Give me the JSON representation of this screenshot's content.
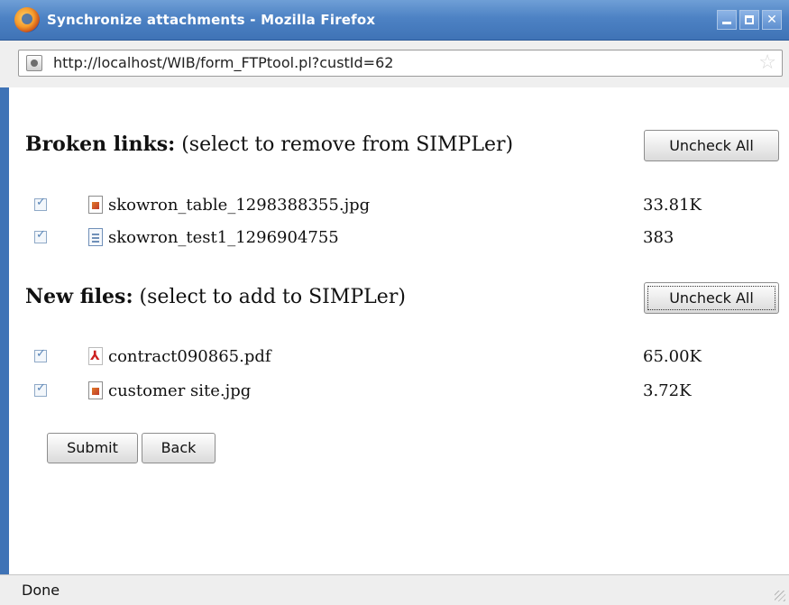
{
  "window": {
    "title": "Synchronize attachments - Mozilla Firefox",
    "icon": "firefox-icon",
    "controls": [
      "minimize-icon",
      "maximize-icon",
      "close-icon"
    ]
  },
  "urlbar": {
    "url": "http://localhost/WIB/form_FTPtool.pl?custId=62",
    "site_icon": "site-identity-icon",
    "bookmark_icon": "bookmark-star-icon"
  },
  "broken_links": {
    "heading_bold": "Broken links:",
    "heading_rest": " (select to remove from SIMPLer)",
    "uncheck_label": "Uncheck All",
    "items": [
      {
        "name": "skowron_table_1298388355.jpg",
        "size": "33.81K",
        "checked": true,
        "icon": "image-file-icon"
      },
      {
        "name": "skowron_test1_1296904755",
        "size": "383",
        "checked": true,
        "icon": "text-file-icon"
      }
    ]
  },
  "new_files": {
    "heading_bold": "New files:",
    "heading_rest": " (select to add to SIMPLer)",
    "uncheck_label": "Uncheck All",
    "items": [
      {
        "name": "contract090865.pdf",
        "size": "65.00K",
        "checked": true,
        "icon": "pdf-file-icon"
      },
      {
        "name": "customer site.jpg",
        "size": "3.72K",
        "checked": true,
        "icon": "image-file-icon"
      }
    ]
  },
  "actions": {
    "submit_label": "Submit",
    "back_label": "Back"
  },
  "status": {
    "text": "Done"
  }
}
